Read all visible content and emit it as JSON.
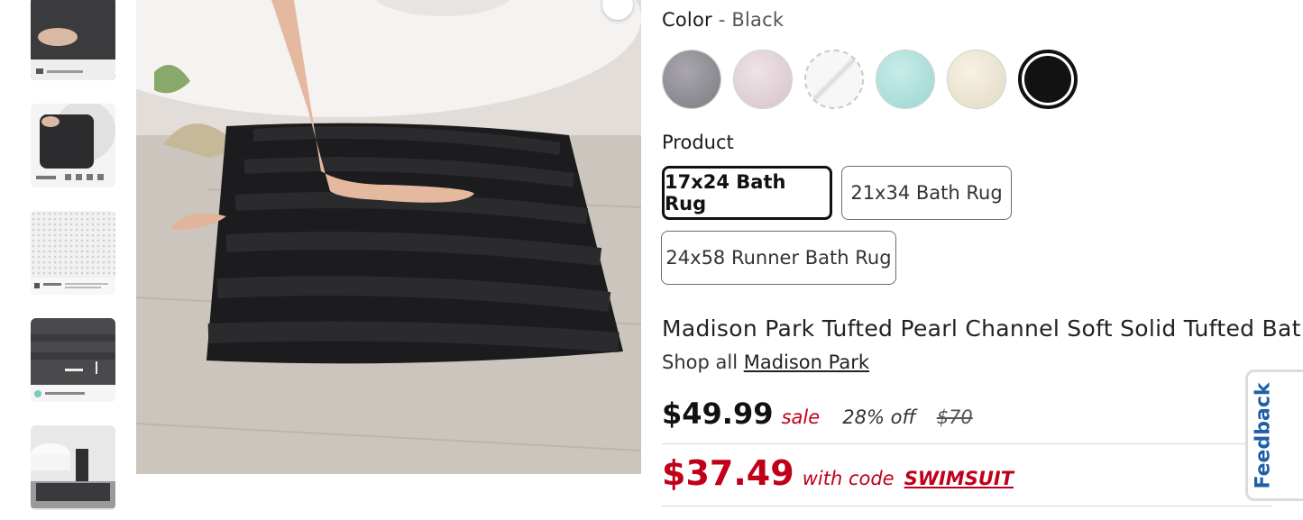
{
  "color": {
    "label": "Color",
    "separator": "-",
    "selected": "Black",
    "swatches": [
      {
        "name": "grey",
        "color": "#8c8a90"
      },
      {
        "name": "blush",
        "color": "#e2d2d6"
      },
      {
        "name": "white",
        "color": "#f2f2f2"
      },
      {
        "name": "aqua",
        "color": "#aee0dc"
      },
      {
        "name": "ivory",
        "color": "#eee7d5"
      },
      {
        "name": "black",
        "color": "#141414"
      }
    ]
  },
  "product": {
    "label": "Product",
    "options": [
      "17x24 Bath Rug",
      "21x34 Bath Rug",
      "24x58 Runner Bath Rug"
    ],
    "selected": "17x24 Bath Rug"
  },
  "title": "Madison Park Tufted Pearl Channel Soft Solid Tufted Bath Rug",
  "shop": {
    "prefix": "Shop all",
    "brand": "Madison Park"
  },
  "pricing": {
    "price": "$49.99",
    "sale_label": "sale",
    "discount": "28% off",
    "original": "$70",
    "coupon_price": "$37.49",
    "with_code": "with code",
    "code": "SWIMSUIT"
  },
  "feedback_label": "Feedback",
  "accent_colors": {
    "sale_red": "#c0001a",
    "feedback_blue": "#1f5fa8"
  }
}
